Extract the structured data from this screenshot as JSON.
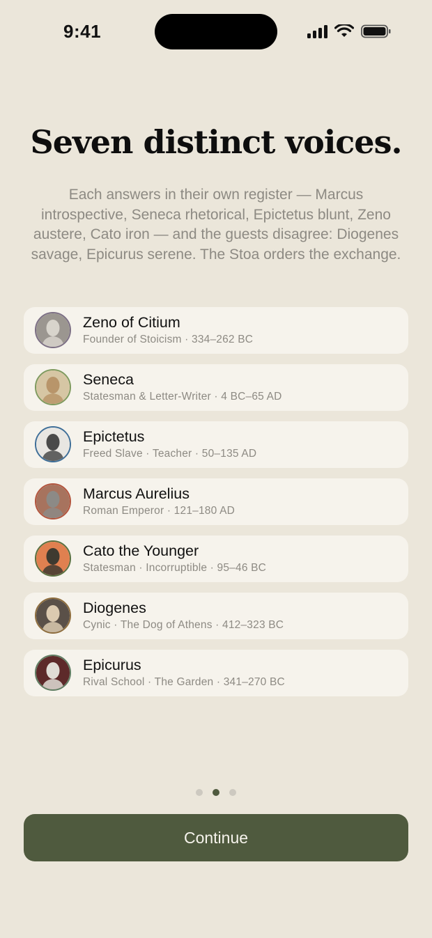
{
  "status": {
    "time": "9:41"
  },
  "title": "Seven distinct voices.",
  "subtitle": "Each answers in their own register — Marcus introspective, Seneca rhetorical, Epictetus blunt, Zeno austere, Cato iron — and the guests disagree: Diogenes savage, Epicurus serene. The Stoa orders the exchange.",
  "philosophers": [
    {
      "name": "Zeno of Citium",
      "desc": "Founder of Stoicism · 334–262 BC",
      "ring": "#7c6f84",
      "bg": "#9b9690",
      "face": "#d8d4cc"
    },
    {
      "name": "Seneca",
      "desc": "Statesman & Letter-Writer · 4 BC–65 AD",
      "ring": "#7f9a5e",
      "bg": "#d6c6a4",
      "face": "#b8956a"
    },
    {
      "name": "Epictetus",
      "desc": "Freed Slave · Teacher · 50–135 AD",
      "ring": "#3e6e98",
      "bg": "#e8e6e2",
      "face": "#4a4a4a"
    },
    {
      "name": "Marcus Aurelius",
      "desc": "Roman Emperor · 121–180 AD",
      "ring": "#b2553e",
      "bg": "#a7735e",
      "face": "#8c8a86"
    },
    {
      "name": "Cato the Younger",
      "desc": "Statesman · Incorruptible · 95–46 BC",
      "ring": "#5a7040",
      "bg": "#e08050",
      "face": "#3e3a30"
    },
    {
      "name": "Diogenes",
      "desc": "Cynic · The Dog of Athens · 412–323 BC",
      "ring": "#8e6d3d",
      "bg": "#5a5048",
      "face": "#dccab0"
    },
    {
      "name": "Epicurus",
      "desc": "Rival School · The Garden · 341–270 BC",
      "ring": "#5f7d62",
      "bg": "#5d2a2a",
      "face": "#e0ddd6"
    }
  ],
  "pager": {
    "count": 3,
    "active": 1
  },
  "continue_label": "Continue"
}
